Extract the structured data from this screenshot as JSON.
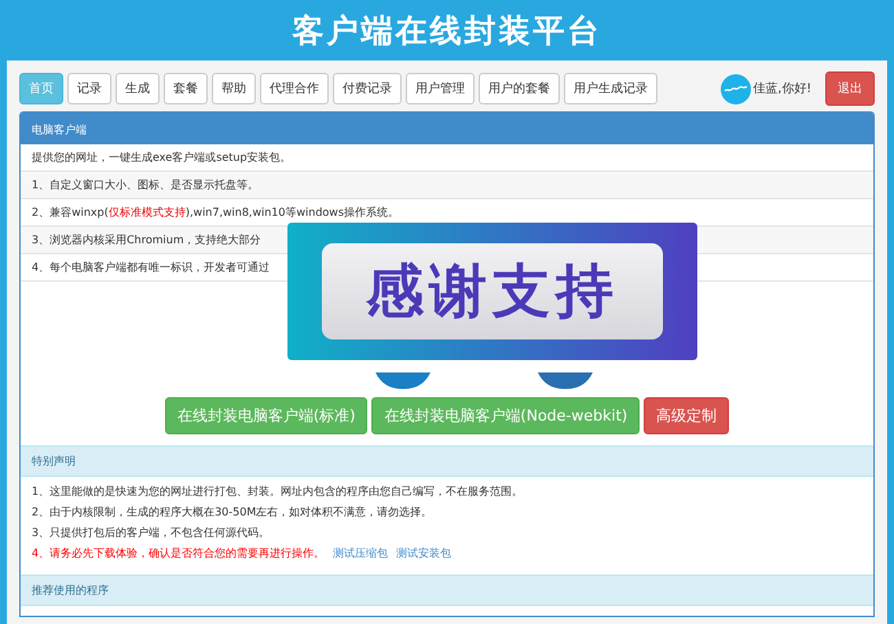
{
  "header": {
    "title": "客户端在线封装平台"
  },
  "nav": {
    "tabs": [
      {
        "label": "首页",
        "selected": true
      },
      {
        "label": "记录",
        "selected": false
      },
      {
        "label": "生成",
        "selected": false
      },
      {
        "label": "套餐",
        "selected": false
      },
      {
        "label": "帮助",
        "selected": false
      },
      {
        "label": "代理合作",
        "selected": false
      },
      {
        "label": "付费记录",
        "selected": false
      },
      {
        "label": "用户管理",
        "selected": false
      },
      {
        "label": "用户的套餐",
        "selected": false
      },
      {
        "label": "用户生成记录",
        "selected": false
      }
    ],
    "greeting": "佳蓝,你好!",
    "logout": "退出"
  },
  "client_panel": {
    "heading": "电脑客户端",
    "items": [
      {
        "segments": [
          {
            "text": "提供您的网址，一键生成exe客户端或setup安装包。",
            "emphasis": false
          }
        ]
      },
      {
        "segments": [
          {
            "text": "1、自定义窗口大小、图标、是否显示托盘等。",
            "emphasis": false
          }
        ]
      },
      {
        "segments": [
          {
            "text": "2、兼容winxp(",
            "emphasis": false
          },
          {
            "text": "仅标准模式支持",
            "emphasis": true
          },
          {
            "text": "),win7,win8,win10等windows操作系统。",
            "emphasis": false
          }
        ]
      },
      {
        "segments": [
          {
            "text": "3、浏览器内核采用Chromium，支持绝大部分",
            "emphasis": false
          }
        ]
      },
      {
        "segments": [
          {
            "text": "4、每个电脑客户端都有唯一标识，开发者可通过",
            "emphasis": false
          }
        ]
      }
    ]
  },
  "actions": [
    {
      "label": "在线封装电脑客户端(标准)",
      "kind": "success"
    },
    {
      "label": "在线封装电脑客户端(Node-webkit)",
      "kind": "success"
    },
    {
      "label": "高级定制",
      "kind": "danger"
    }
  ],
  "notice": {
    "heading": "特别声明",
    "items": [
      {
        "text": "1、这里能做的是快速为您的网址进行打包、封装。网址内包含的程序由您自己编写，不在服务范围。",
        "warning": false
      },
      {
        "text": "2、由于内核限制，生成的程序大概在30-50M左右，如对体积不满意，请勿选择。",
        "warning": false
      },
      {
        "text": "3、只提供打包后的客户端，不包含任何源代码。",
        "warning": false
      },
      {
        "text": "4、请务必先下载体验，确认是否符合您的需要再进行操作。",
        "warning": true,
        "links": [
          "测试压缩包",
          "测试安装包"
        ]
      }
    ]
  },
  "recommended": {
    "heading": "推荐使用的程序"
  },
  "overlay": {
    "text": "感谢支持"
  }
}
